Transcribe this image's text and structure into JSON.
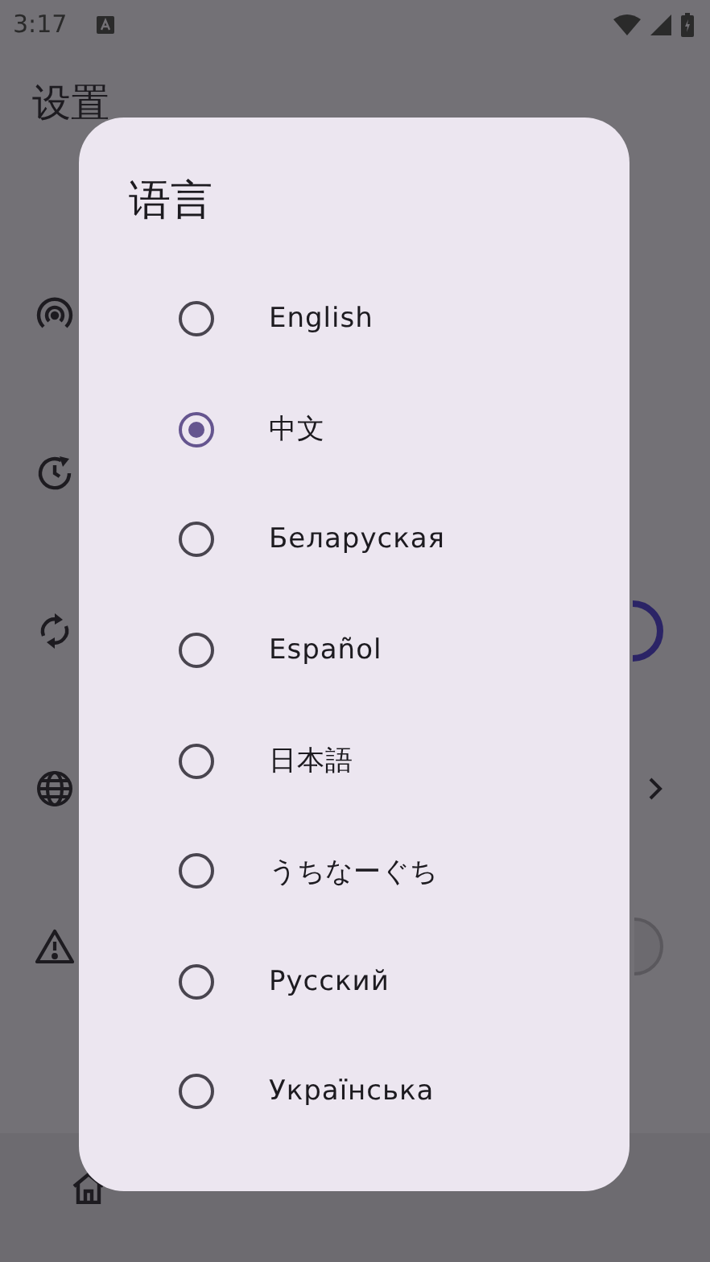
{
  "status_bar": {
    "time": "3:17"
  },
  "app_bar": {
    "title": "设置"
  },
  "dialog": {
    "title": "语言",
    "options": [
      {
        "label": "English",
        "selected": false
      },
      {
        "label": "中文",
        "selected": true
      },
      {
        "label": "Беларуская",
        "selected": false
      },
      {
        "label": "Español",
        "selected": false
      },
      {
        "label": "日本語",
        "selected": false
      },
      {
        "label": "うちなーぐち",
        "selected": false
      },
      {
        "label": "Русский",
        "selected": false
      },
      {
        "label": "Українська",
        "selected": false
      }
    ]
  }
}
